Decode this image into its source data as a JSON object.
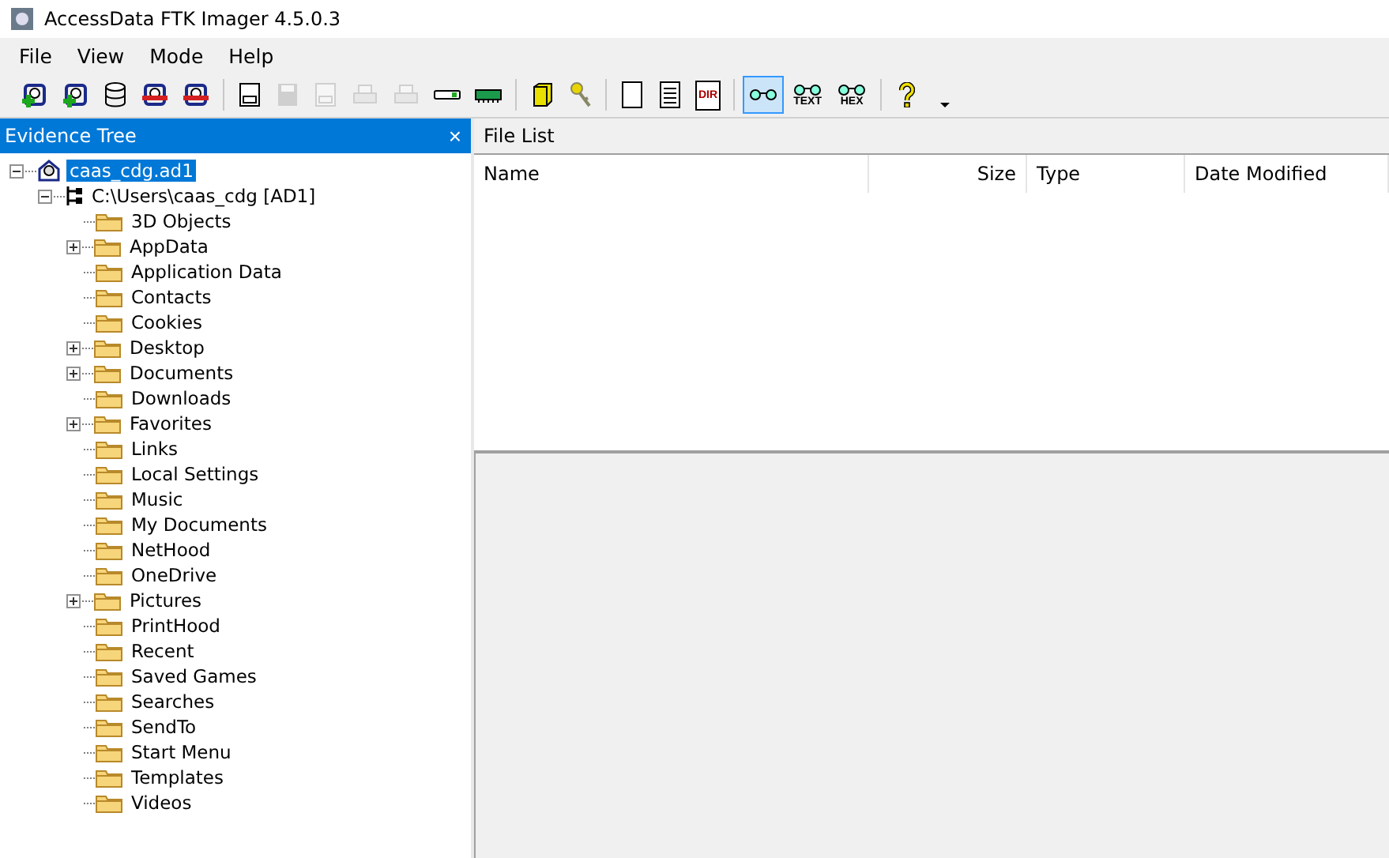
{
  "window": {
    "title": "AccessData FTK Imager 4.5.0.3"
  },
  "menu": [
    "File",
    "View",
    "Mode",
    "Help"
  ],
  "toolbar": [
    {
      "kind": "add",
      "disabled": false,
      "selected": false
    },
    {
      "kind": "addall",
      "disabled": false,
      "selected": false
    },
    {
      "kind": "disks",
      "disabled": false,
      "selected": false
    },
    {
      "kind": "remove",
      "disabled": false,
      "selected": false
    },
    {
      "kind": "removeall",
      "disabled": false,
      "selected": false
    },
    {
      "kind": "sep"
    },
    {
      "kind": "drive",
      "disabled": false,
      "selected": false
    },
    {
      "kind": "floppy",
      "disabled": true,
      "selected": false
    },
    {
      "kind": "drive",
      "disabled": true,
      "selected": false
    },
    {
      "kind": "printer",
      "disabled": true,
      "selected": false
    },
    {
      "kind": "printer",
      "disabled": true,
      "selected": false
    },
    {
      "kind": "stick",
      "disabled": false,
      "selected": false
    },
    {
      "kind": "memory",
      "disabled": false,
      "selected": false
    },
    {
      "kind": "sep"
    },
    {
      "kind": "box",
      "disabled": false,
      "selected": false
    },
    {
      "kind": "key",
      "disabled": false,
      "selected": false
    },
    {
      "kind": "sep"
    },
    {
      "kind": "page",
      "disabled": false,
      "selected": false
    },
    {
      "kind": "textpage",
      "disabled": false,
      "selected": false
    },
    {
      "kind": "labelpage",
      "label": "DIR",
      "disabled": false,
      "selected": false
    },
    {
      "kind": "sep"
    },
    {
      "kind": "glasses",
      "disabled": false,
      "selected": true
    },
    {
      "kind": "glasses",
      "label": "TEXT",
      "disabled": false,
      "selected": false
    },
    {
      "kind": "glasses",
      "label": "HEX",
      "disabled": false,
      "selected": false
    },
    {
      "kind": "sep"
    },
    {
      "kind": "help",
      "disabled": false,
      "selected": false
    },
    {
      "kind": "caret",
      "disabled": false,
      "selected": false
    }
  ],
  "evidence_tree": {
    "title": "Evidence Tree",
    "close": "×",
    "items": [
      {
        "label": "caas_cdg.ad1",
        "kind": "evidence",
        "selected": true,
        "expanded": true,
        "children": [
          {
            "label": "C:\\Users\\caas_cdg [AD1]",
            "kind": "root",
            "selected": false,
            "expanded": true,
            "children": [
              {
                "label": "3D Objects",
                "kind": "folder",
                "selected": false
              },
              {
                "label": "AppData",
                "kind": "folder",
                "selected": false,
                "expanded": false
              },
              {
                "label": "Application Data",
                "kind": "folder",
                "selected": false
              },
              {
                "label": "Contacts",
                "kind": "folder",
                "selected": false
              },
              {
                "label": "Cookies",
                "kind": "folder",
                "selected": false
              },
              {
                "label": "Desktop",
                "kind": "folder",
                "selected": false,
                "expanded": false
              },
              {
                "label": "Documents",
                "kind": "folder",
                "selected": false,
                "expanded": false
              },
              {
                "label": "Downloads",
                "kind": "folder",
                "selected": false
              },
              {
                "label": "Favorites",
                "kind": "folder",
                "selected": false,
                "expanded": false
              },
              {
                "label": "Links",
                "kind": "folder",
                "selected": false
              },
              {
                "label": "Local Settings",
                "kind": "folder",
                "selected": false
              },
              {
                "label": "Music",
                "kind": "folder",
                "selected": false
              },
              {
                "label": "My Documents",
                "kind": "folder",
                "selected": false
              },
              {
                "label": "NetHood",
                "kind": "folder",
                "selected": false
              },
              {
                "label": "OneDrive",
                "kind": "folder",
                "selected": false
              },
              {
                "label": "Pictures",
                "kind": "folder",
                "selected": false,
                "expanded": false
              },
              {
                "label": "PrintHood",
                "kind": "folder",
                "selected": false
              },
              {
                "label": "Recent",
                "kind": "folder",
                "selected": false
              },
              {
                "label": "Saved Games",
                "kind": "folder",
                "selected": false
              },
              {
                "label": "Searches",
                "kind": "folder",
                "selected": false
              },
              {
                "label": "SendTo",
                "kind": "folder",
                "selected": false
              },
              {
                "label": "Start Menu",
                "kind": "folder",
                "selected": false
              },
              {
                "label": "Templates",
                "kind": "folder",
                "selected": false
              },
              {
                "label": "Videos",
                "kind": "folder",
                "selected": false
              }
            ]
          }
        ]
      }
    ]
  },
  "file_list": {
    "title": "File List",
    "columns": [
      "Name",
      "Size",
      "Type",
      "Date Modified"
    ]
  }
}
